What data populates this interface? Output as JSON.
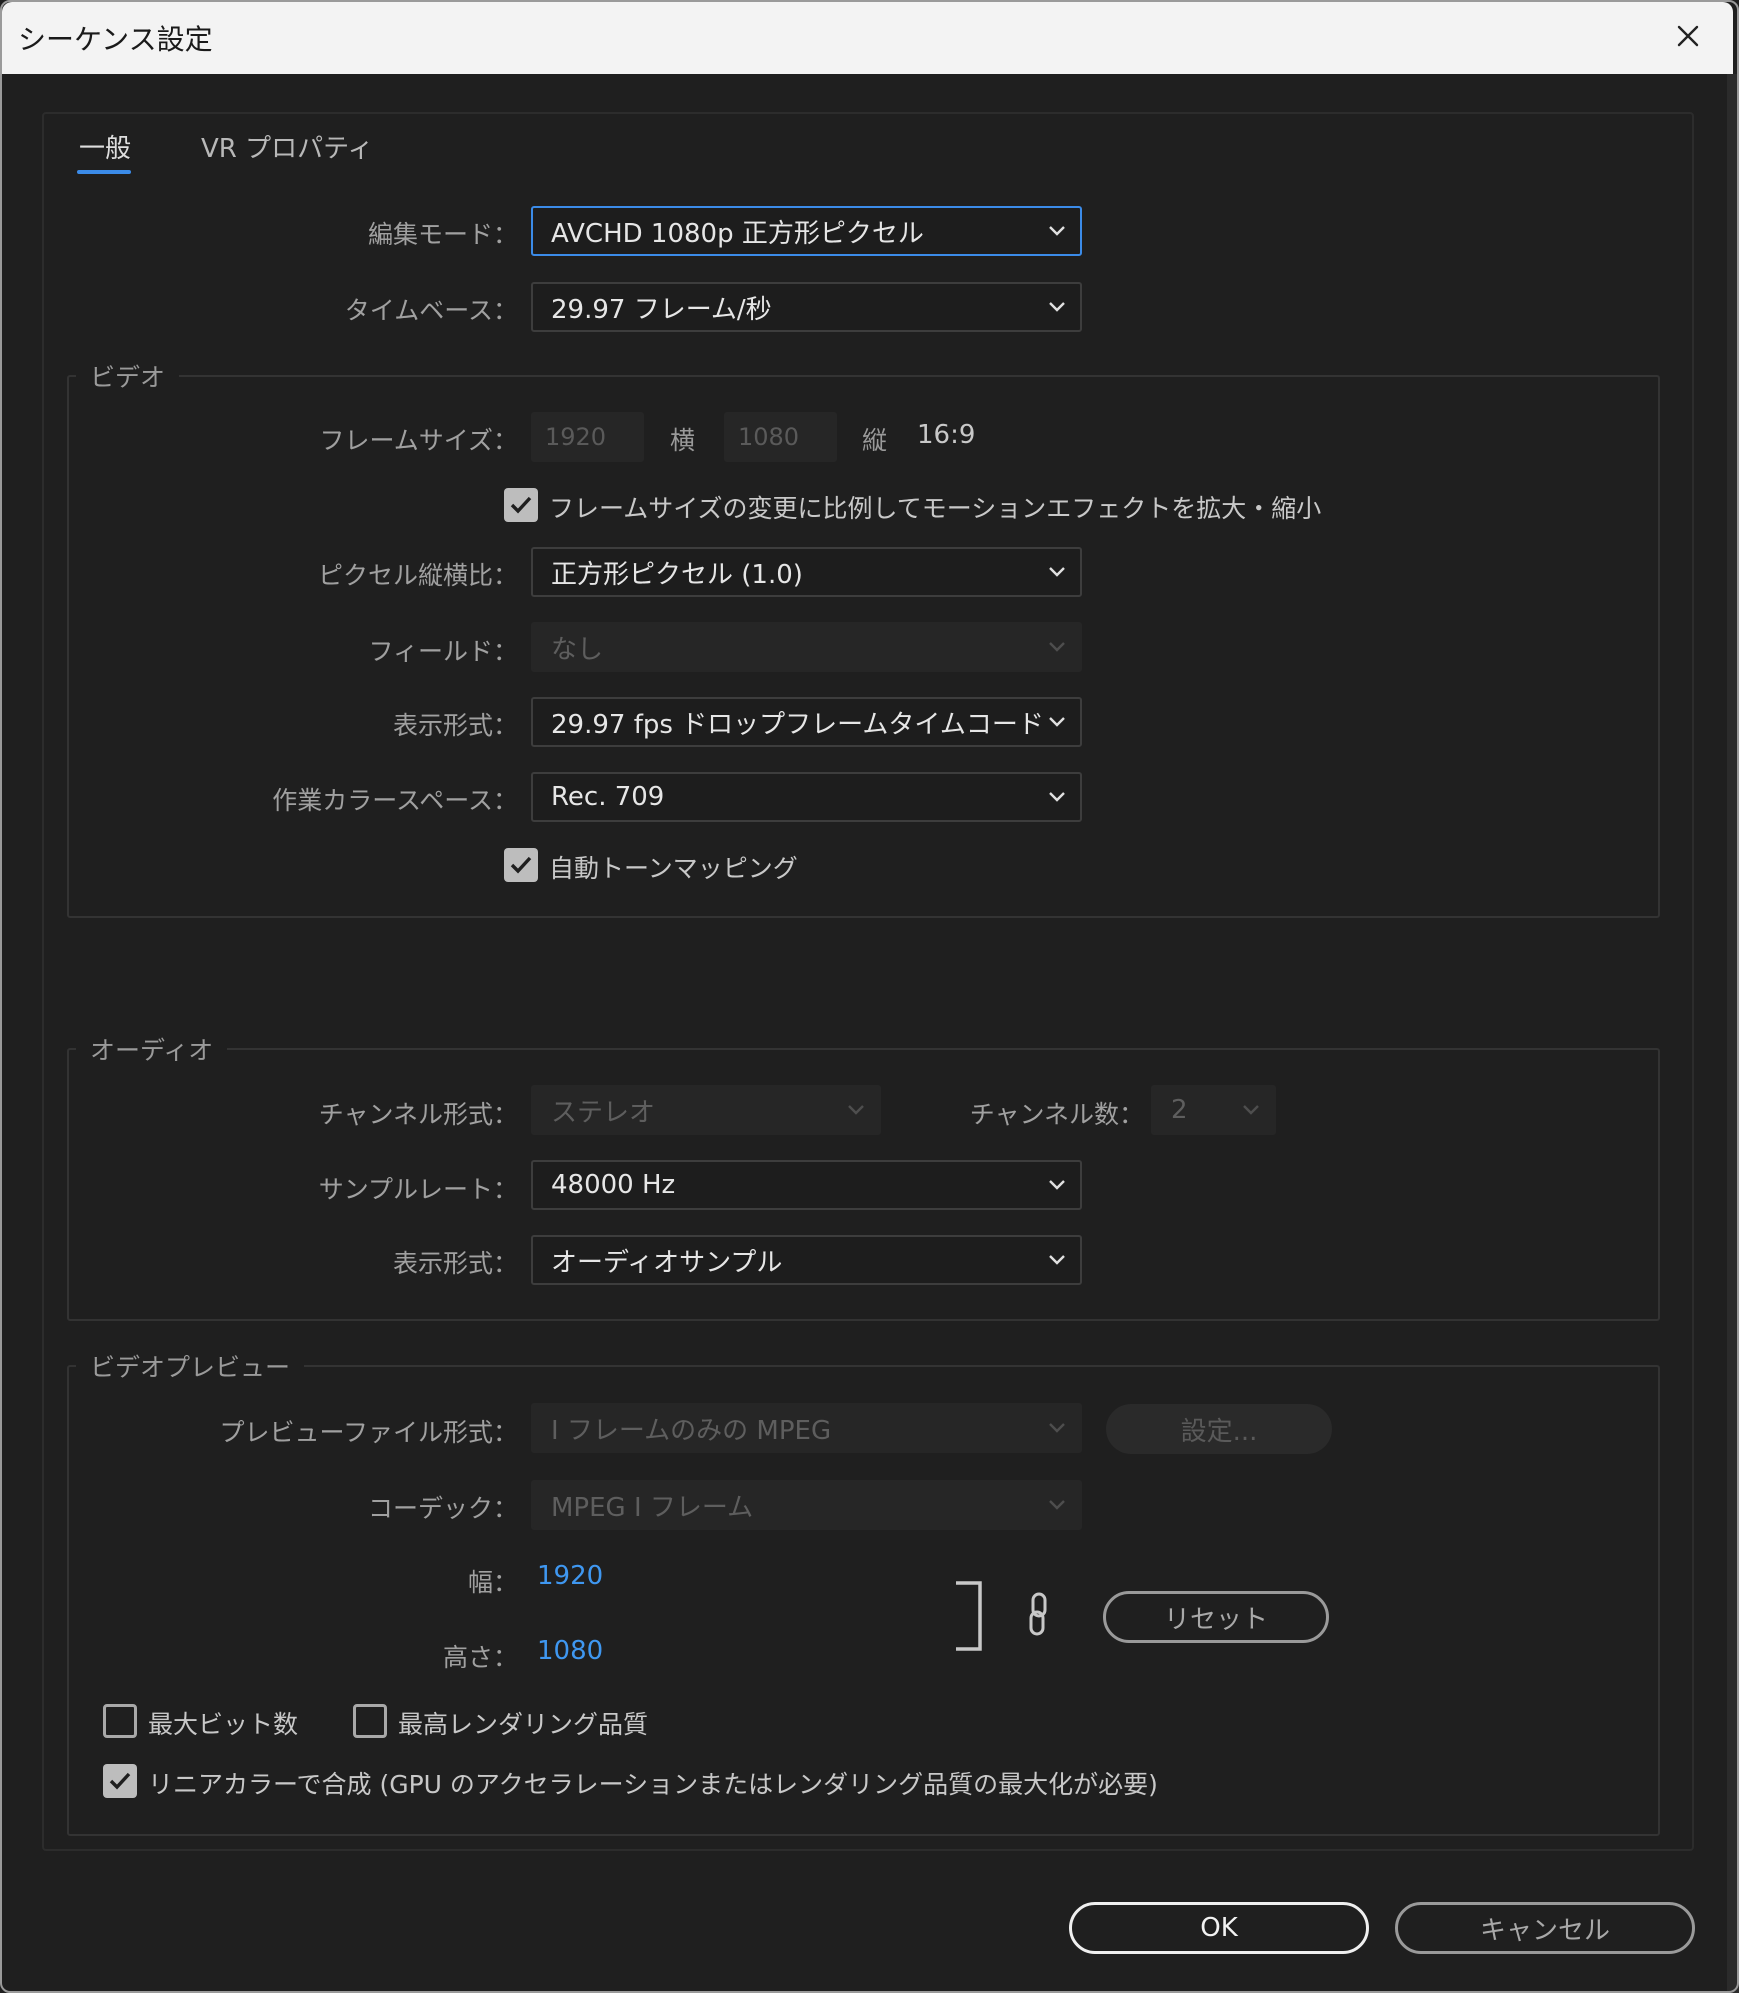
{
  "window": {
    "title": "シーケンス設定"
  },
  "tabs": [
    {
      "label": "一般",
      "active": true
    },
    {
      "label": "VR プロパティ",
      "active": false
    }
  ],
  "general": {
    "edit_mode": {
      "label": "編集モード：",
      "value": "AVCHD 1080p 正方形ピクセル"
    },
    "timebase": {
      "label": "タイムベース：",
      "value": "29.97  フレーム/秒"
    }
  },
  "video": {
    "title": "ビデオ",
    "frame_size": {
      "label": "フレームサイズ：",
      "width": "1920",
      "width_label": "横",
      "height": "1080",
      "height_label": "縦",
      "aspect": "16:9"
    },
    "scale_motion_checkbox": {
      "label": "フレームサイズの変更に比例してモーションエフェクトを拡大・縮小",
      "checked": true
    },
    "pixel_aspect": {
      "label": "ピクセル縦横比：",
      "value": "正方形ピクセル (1.0)"
    },
    "fields": {
      "label": "フィールド：",
      "value": "なし"
    },
    "display_format": {
      "label": "表示形式：",
      "value": "29.97 fps ドロップフレームタイムコード"
    },
    "color_space": {
      "label": "作業カラースペース：",
      "value": "Rec. 709"
    },
    "tone_mapping_checkbox": {
      "label": "自動トーンマッピング",
      "checked": true
    }
  },
  "audio": {
    "title": "オーディオ",
    "channel_format": {
      "label": "チャンネル形式：",
      "value": "ステレオ"
    },
    "channel_count": {
      "label": "チャンネル数：",
      "value": "2"
    },
    "sample_rate": {
      "label": "サンプルレート：",
      "value": "48000 Hz"
    },
    "display_format": {
      "label": "表示形式：",
      "value": "オーディオサンプル"
    }
  },
  "video_preview": {
    "title": "ビデオプレビュー",
    "file_format": {
      "label": "プレビューファイル形式：",
      "value": "I フレームのみの MPEG"
    },
    "settings_button": "設定...",
    "codec": {
      "label": "コーデック：",
      "value": "MPEG I フレーム"
    },
    "width": {
      "label": "幅：",
      "value": "1920"
    },
    "height": {
      "label": "高さ：",
      "value": "1080"
    },
    "reset_button": "リセット",
    "max_bit_depth": {
      "label": "最大ビット数",
      "checked": false
    },
    "max_render_quality": {
      "label": "最高レンダリング品質",
      "checked": false
    },
    "linear_color": {
      "label": "リニアカラーで合成 (GPU のアクセラレーションまたはレンダリング品質の最大化が必要)",
      "checked": true
    }
  },
  "footer": {
    "ok": "OK",
    "cancel": "キャンセル"
  },
  "colors": {
    "accent": "#3b8be8",
    "link_value": "#3f97f0",
    "background": "#1f1f1f",
    "titlebar": "#f3f3f3"
  },
  "icons": [
    "close-icon",
    "chevron-down-icon",
    "checkmark-icon",
    "chain-link-icon",
    "bracket-icon"
  ]
}
